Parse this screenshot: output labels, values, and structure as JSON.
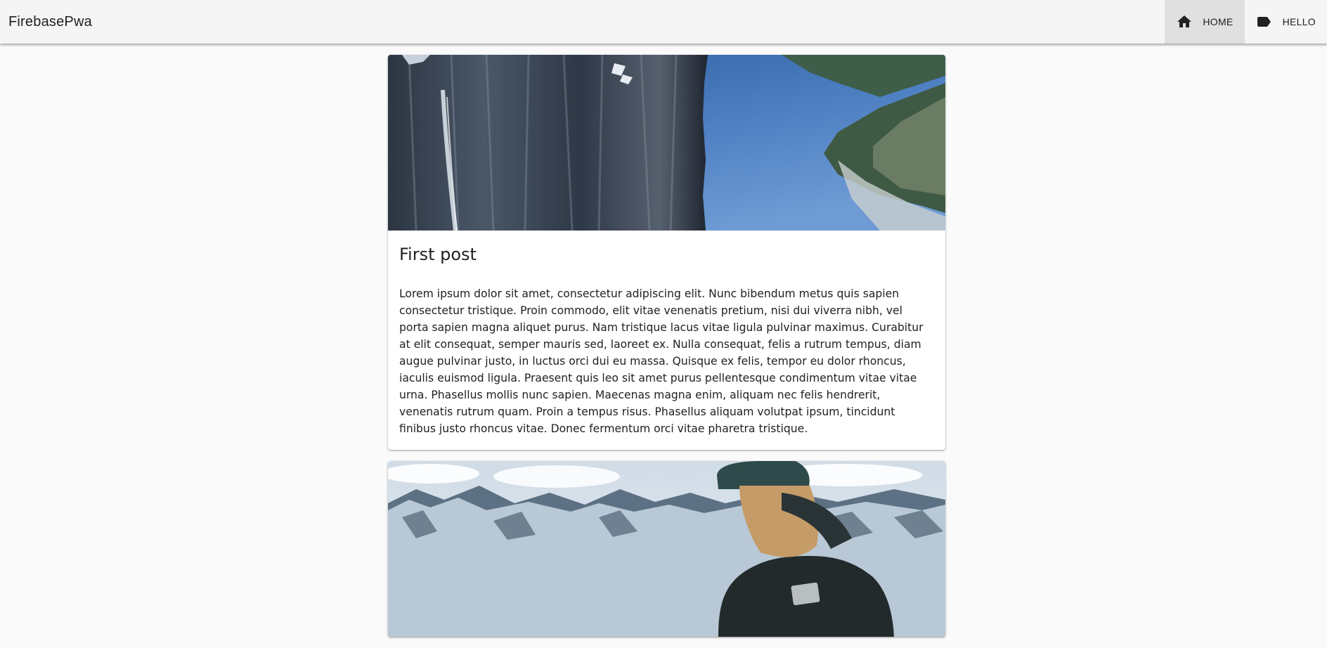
{
  "app": {
    "title": "FirebasePwa"
  },
  "nav": {
    "items": [
      {
        "label": "HOME",
        "icon": "home-icon",
        "active": true
      },
      {
        "label": "HELLO",
        "icon": "label-icon",
        "active": false
      }
    ]
  },
  "posts": [
    {
      "title": "First post",
      "image": "cliff-fjord-photo",
      "body": "Lorem ipsum dolor sit amet, consectetur adipiscing elit. Nunc bibendum metus quis sapien consectetur tristique. Proin commodo, elit vitae venenatis pretium, nisi dui viverra nibh, vel porta sapien magna aliquet purus. Nam tristique lacus vitae ligula pulvinar maximus. Curabitur at elit consequat, semper mauris sed, laoreet ex. Nulla consequat, felis a rutrum tempus, diam augue pulvinar justo, in luctus orci dui eu massa. Quisque ex felis, tempor eu dolor rhoncus, iaculis euismod ligula. Praesent quis leo sit amet purus pellentesque condimentum vitae vitae urna. Phasellus mollis nunc sapien. Maecenas magna enim, aliquam nec felis hendrerit, venenatis rutrum quam. Proin a tempus risus. Phasellus aliquam volutpat ipsum, tincidunt finibus justo rhoncus vitae. Donec fermentum orci vitae pharetra tristique."
    },
    {
      "image": "mountain-hiker-photo"
    }
  ],
  "colors": {
    "toolbar_bg": "#f5f5f5",
    "active_nav_bg": "#e0e0e0",
    "page_bg": "#fafafa",
    "text": "#212121"
  }
}
